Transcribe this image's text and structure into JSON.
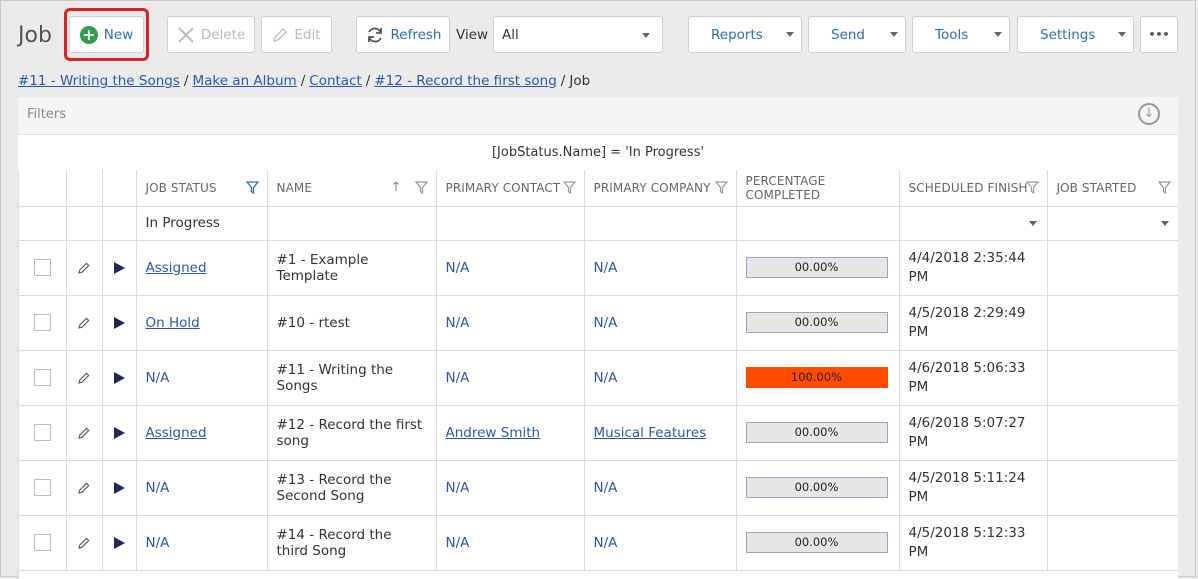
{
  "page_title": "Job",
  "toolbar": {
    "new_label": "New",
    "delete_label": "Delete",
    "edit_label": "Edit",
    "refresh_label": "Refresh",
    "view_label": "View",
    "view_value": "All",
    "reports_label": "Reports",
    "send_label": "Send",
    "tools_label": "Tools",
    "settings_label": "Settings",
    "more_label": "•••"
  },
  "breadcrumb": [
    {
      "label": "#11 - Writing the Songs",
      "link": true
    },
    {
      "label": "Make an Album",
      "link": true
    },
    {
      "label": "Contact",
      "link": true
    },
    {
      "label": "#12 - Record the first song",
      "link": true
    },
    {
      "label": "Job",
      "link": false
    }
  ],
  "filters": {
    "label": "Filters",
    "expression": "[JobStatus.Name] = 'In Progress'"
  },
  "columns": {
    "job_status": "JOB STATUS",
    "name": "NAME",
    "primary_contact": "PRIMARY CONTACT",
    "primary_company": "PRIMARY COMPANY",
    "percentage_completed": "PERCENTAGE COMPLETED",
    "scheduled_finish": "SCHEDULED FINISH",
    "job_started": "JOB STARTED"
  },
  "filter_row": {
    "job_status": "In Progress"
  },
  "rows": [
    {
      "status": "Assigned",
      "status_link": true,
      "name": "#1 - Example Template",
      "contact": "N/A",
      "contact_link": false,
      "company": "N/A",
      "company_link": false,
      "percent": "00.00%",
      "percent_value": 0,
      "sched_date": "4/4/2018 2:35:44",
      "sched_ampm": "PM",
      "started": ""
    },
    {
      "status": "On Hold",
      "status_link": true,
      "name": "#10 - rtest",
      "contact": "N/A",
      "contact_link": false,
      "company": "N/A",
      "company_link": false,
      "percent": "00.00%",
      "percent_value": 0,
      "sched_date": "4/5/2018 2:29:49",
      "sched_ampm": "PM",
      "started": ""
    },
    {
      "status": "N/A",
      "status_link": false,
      "name": "#11 - Writing the Songs",
      "contact": "N/A",
      "contact_link": false,
      "company": "N/A",
      "company_link": false,
      "percent": "100.00%",
      "percent_value": 100,
      "sched_date": "4/6/2018 5:06:33",
      "sched_ampm": "PM",
      "started": ""
    },
    {
      "status": "Assigned",
      "status_link": true,
      "name": "#12 - Record the first song",
      "contact": "Andrew Smith",
      "contact_link": true,
      "company": "Musical Features",
      "company_link": true,
      "percent": "00.00%",
      "percent_value": 0,
      "sched_date": "4/6/2018 5:07:27",
      "sched_ampm": "PM",
      "started": ""
    },
    {
      "status": "N/A",
      "status_link": false,
      "name": "#13 - Record the Second Song",
      "contact": "N/A",
      "contact_link": false,
      "company": "N/A",
      "company_link": false,
      "percent": "00.00%",
      "percent_value": 0,
      "sched_date": "4/5/2018 5:11:24",
      "sched_ampm": "PM",
      "started": ""
    },
    {
      "status": "N/A",
      "status_link": false,
      "name": "#14 - Record the third Song",
      "contact": "N/A",
      "contact_link": false,
      "company": "N/A",
      "company_link": false,
      "percent": "00.00%",
      "percent_value": 0,
      "sched_date": "4/5/2018 5:12:33",
      "sched_ampm": "PM",
      "started": ""
    }
  ],
  "colors": {
    "link": "#2a57b0",
    "new_icon": "#2e9e4a",
    "highlight": "#e02020",
    "progress_full": "#ff4a00",
    "progress_empty": "#e6e6e6"
  }
}
